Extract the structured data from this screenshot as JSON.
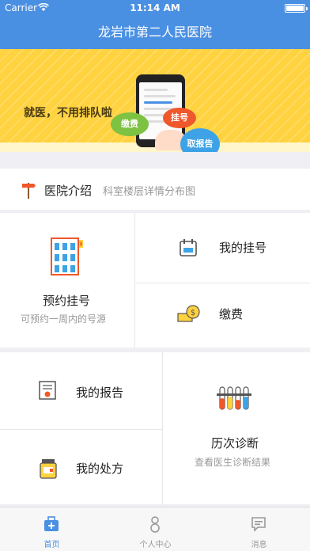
{
  "status_bar": {
    "carrier": "Carrier",
    "time": "11:14 AM"
  },
  "nav": {
    "title": "龙岩市第二人民医院"
  },
  "banner": {
    "slogan": "就医，不用排队啦",
    "bubble_pay": "缴费",
    "bubble_register": "挂号",
    "bubble_report": "取报告"
  },
  "intro": {
    "title": "医院介绍",
    "subtitle": "科室楼层详情分布图"
  },
  "tiles": {
    "appointment": {
      "label": "预约挂号",
      "sub": "可预约一周内的号源"
    },
    "my_registration": {
      "label": "我的挂号"
    },
    "payment": {
      "label": "缴费"
    },
    "my_report": {
      "label": "我的报告"
    },
    "my_prescription": {
      "label": "我的处方"
    },
    "history": {
      "label": "历次诊断",
      "sub": "查看医生诊断结果"
    }
  },
  "tabs": [
    {
      "label": "首页",
      "active": true
    },
    {
      "label": "个人中心",
      "active": false
    },
    {
      "label": "消息",
      "active": false
    }
  ],
  "colors": {
    "primary": "#4a90e2",
    "banner": "#ffd23f",
    "active_tab": "#4a90e2",
    "inactive_tab": "#999999"
  }
}
